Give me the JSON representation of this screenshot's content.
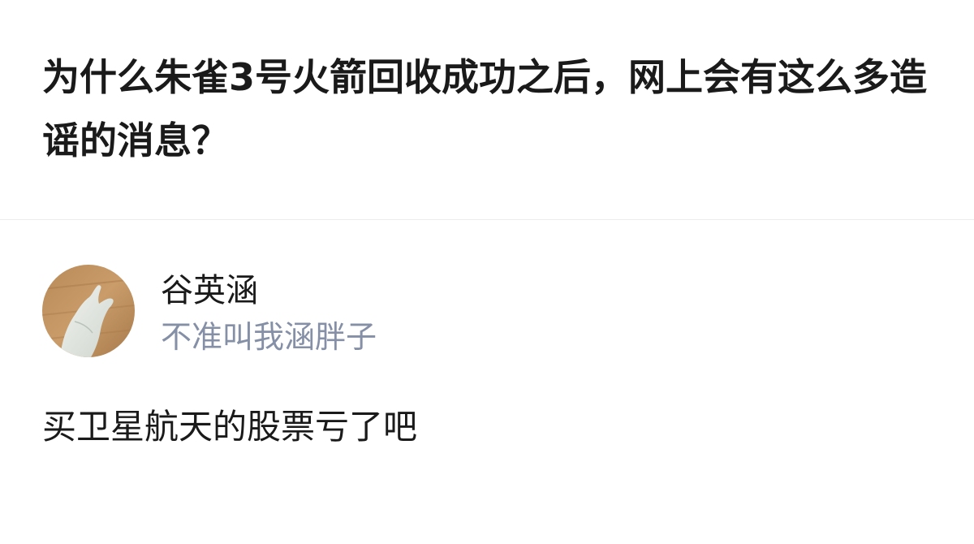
{
  "question": {
    "title": "为什么朱雀3号火箭回收成功之后，网上会有这么多造谣的消息？"
  },
  "author": {
    "name": "谷英涵",
    "bio": "不准叫我涵胖子",
    "avatar_icon": "hand-on-wood-avatar"
  },
  "answer": {
    "text": "买卫星航天的股票亏了吧"
  },
  "colors": {
    "title": "#1a1a1a",
    "bio": "#8590a6",
    "divider": "#ececec",
    "background": "#ffffff"
  }
}
